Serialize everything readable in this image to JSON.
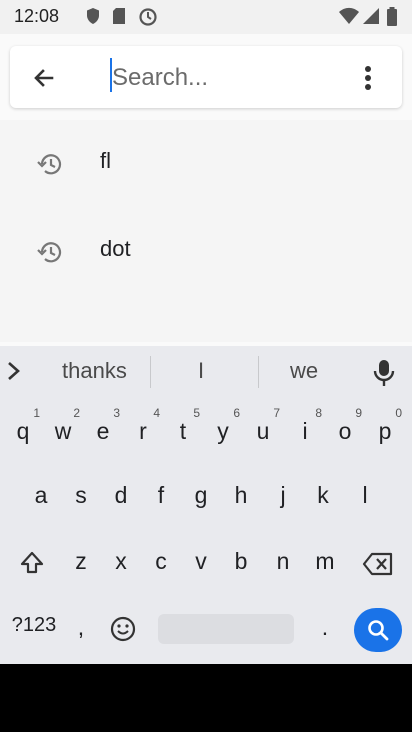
{
  "status_bar": {
    "time": "12:08"
  },
  "search": {
    "placeholder": "Search..."
  },
  "suggestions": [
    {
      "text": "fl"
    },
    {
      "text": "dot"
    }
  ],
  "keyboard": {
    "predictions": [
      "thanks",
      "I",
      "we"
    ],
    "row1": [
      {
        "l": "q",
        "n": "1"
      },
      {
        "l": "w",
        "n": "2"
      },
      {
        "l": "e",
        "n": "3"
      },
      {
        "l": "r",
        "n": "4"
      },
      {
        "l": "t",
        "n": "5"
      },
      {
        "l": "y",
        "n": "6"
      },
      {
        "l": "u",
        "n": "7"
      },
      {
        "l": "i",
        "n": "8"
      },
      {
        "l": "o",
        "n": "9"
      },
      {
        "l": "p",
        "n": "0"
      }
    ],
    "row2": [
      "a",
      "s",
      "d",
      "f",
      "g",
      "h",
      "j",
      "k",
      "l"
    ],
    "row3": [
      "z",
      "x",
      "c",
      "v",
      "b",
      "n",
      "m"
    ],
    "symbols_label": "?123",
    "comma": ",",
    "period": "."
  },
  "colors": {
    "accent": "#1a73e8",
    "keyboard_bg": "#e9eaee",
    "search_action": "#1a73e8"
  }
}
